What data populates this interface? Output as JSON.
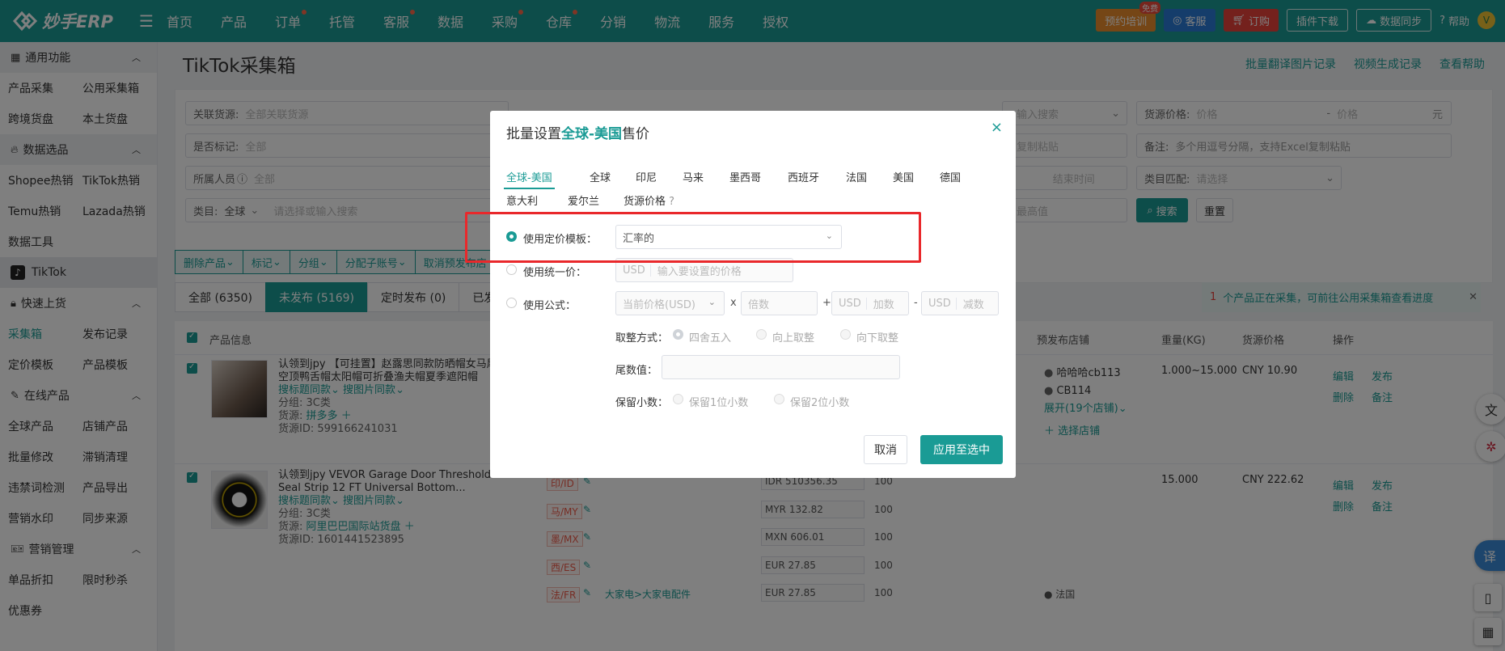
{
  "topbar": {
    "brand": "妙手ERP",
    "nav": [
      {
        "label": "首页",
        "dot": false
      },
      {
        "label": "产品",
        "dot": false
      },
      {
        "label": "订单",
        "dot": true
      },
      {
        "label": "托管",
        "dot": false
      },
      {
        "label": "客服",
        "dot": true
      },
      {
        "label": "数据",
        "dot": false
      },
      {
        "label": "采购",
        "dot": true
      },
      {
        "label": "仓库",
        "dot": true
      },
      {
        "label": "分销",
        "dot": false
      },
      {
        "label": "物流",
        "dot": false
      },
      {
        "label": "服务",
        "dot": false
      },
      {
        "label": "授权",
        "dot": false
      }
    ],
    "training": "预约培训",
    "training_badge": "免费",
    "service": "客服",
    "subscribe": "订购",
    "plugin": "插件下载",
    "sync": "数据同步",
    "help": "帮助",
    "avatar": "V"
  },
  "sidebar": {
    "common": "通用功能",
    "r1": [
      "产品采集",
      "公用采集箱"
    ],
    "r2": [
      "跨境货盘",
      "本土货盘"
    ],
    "data_select": "数据选品",
    "r3": [
      "Shopee热销",
      "TikTok热销"
    ],
    "r4": [
      "Temu热销",
      "Lazada热销"
    ],
    "r5": [
      "数据工具"
    ],
    "tiktok": "TikTok",
    "quick": "快速上货",
    "r6": [
      "采集箱",
      "发布记录"
    ],
    "r7": [
      "定价模板",
      "产品模板"
    ],
    "online": "在线产品",
    "r8": [
      "全球产品",
      "店铺产品"
    ],
    "r9": [
      "批量修改",
      "滞销清理"
    ],
    "r10": [
      "违禁词检测",
      "产品导出"
    ],
    "r11": [
      "营销水印",
      "同步来源"
    ],
    "marketing": "营销管理",
    "r12": [
      "单品折扣",
      "限时秒杀"
    ],
    "r13": [
      "优惠券"
    ]
  },
  "page": {
    "title": "TikTok采集箱",
    "links": [
      "批量翻译图片记录",
      "视频生成记录",
      "查看帮助"
    ]
  },
  "filters": {
    "source_label": "关联货源:",
    "source_ph": "全部关联货源",
    "mark_label": "是否标记:",
    "mark_val": "全部",
    "member_label": "所属人员",
    "member_val": "全部",
    "cat_label": "类目:",
    "cat_val": "全球",
    "cat_ph": "请选择或输入搜索",
    "search_ph": "输入搜索",
    "copy_ph": "复制粘贴",
    "end_time": "结束时间",
    "max_ph": "最高值",
    "price_label": "货源价格:",
    "price_ph": "价格",
    "dash": "-",
    "price_ph2": "价格",
    "yuan": "元",
    "note_label": "备注:",
    "note_ph": "多个用逗号分隔，支持Excel复制粘贴",
    "match_label": "类目匹配:",
    "match_ph": "请选择",
    "search_btn": "搜索",
    "reset_btn": "重置"
  },
  "actions": [
    "删除产品",
    "标记",
    "分组",
    "分配子账号",
    "取消预发布店"
  ],
  "tabs": [
    "全部 (6350)",
    "未发布 (5169)",
    "定时发布 (0)",
    "已发布"
  ],
  "notice": {
    "count": "1",
    "text": "个产品正在采集，可前往公用采集箱查看进度",
    "close": "✕"
  },
  "table": {
    "headers": {
      "info": "产品信息",
      "prestore": "预发布店铺",
      "weight": "重量(KG)",
      "price": "货源价格",
      "op": "操作"
    },
    "rows": [
      {
        "title1": "认领到jpy 【可挂置】赵露思同款防晒帽女马尾",
        "title2": "空顶鸭舌帽太阳帽可折叠渔夫帽夏季遮阳帽",
        "search1": "搜标题同款",
        "search2": "搜图片同款",
        "group": "分组: 3C类",
        "source_label": "货源:",
        "source": "拼多多",
        "sid": "货源ID: 599166241031",
        "stores": [
          "哈哈哈cb113",
          "CB114"
        ],
        "expand": "展开(19个店铺)",
        "choose": "选择店铺",
        "weight": "1.000~15.000",
        "price": "CNY 10.90",
        "ops": [
          "编辑",
          "发布",
          "删除",
          "备注"
        ]
      },
      {
        "title1": "认领到jpy VEVOR Garage Door Threshold",
        "title2": "Seal Strip 12 FT Universal Bottom...",
        "search1": "搜标题同款",
        "search2": "搜图片同款",
        "group": "分组: 3C类",
        "source_label": "货源:",
        "source": "阿里巴巴国际站货盘",
        "sid": "货源ID: 1601441523895",
        "weight": "15.000",
        "price": "CNY 222.62",
        "ops": [
          "编辑",
          "发布",
          "删除",
          "备注"
        ]
      }
    ],
    "subrows": [
      {
        "site": "印/ID",
        "cur": "IDR",
        "price": "510356.35",
        "stock": "100"
      },
      {
        "site": "马/MY",
        "cur": "MYR",
        "price": "132.82",
        "stock": "100"
      },
      {
        "site": "墨/MX",
        "cur": "MXN",
        "price": "606.01",
        "stock": "100"
      },
      {
        "site": "西/ES",
        "cur": "EUR",
        "price": "27.85",
        "stock": "100"
      },
      {
        "site": "法/FR",
        "cat": "大家电>大家电配件",
        "cur": "EUR",
        "price": "27.85",
        "stock": "100",
        "store": "法国"
      }
    ]
  },
  "modal": {
    "title_pre": "批量设置",
    "title_hl": "全球-美国",
    "title_post": "售价",
    "close": "×",
    "tabs": [
      "全球-美国",
      "全球",
      "印尼",
      "马来",
      "墨西哥",
      "西班牙",
      "法国",
      "美国",
      "德国",
      "意大利",
      "爱尔兰",
      "货源价格"
    ],
    "opt_template": "使用定价模板：",
    "template_val": "汇率的",
    "opt_unified": "使用统一价：",
    "usd": "USD",
    "unified_ph": "输入要设置的价格",
    "opt_formula": "使用公式：",
    "formula_base": "当前价格(USD)",
    "x": "x",
    "multiple_ph": "倍数",
    "plus": "+",
    "add_ph": "加数",
    "minus": "-",
    "sub_ph": "减数",
    "round_label": "取整方式：",
    "round_opts": [
      "四舍五入",
      "向上取整",
      "向下取整"
    ],
    "tail_label": "尾数值：",
    "decimal_label": "保留小数：",
    "decimal_opts": [
      "保留1位小数",
      "保留2位小数"
    ],
    "cancel": "取消",
    "apply": "应用至选中"
  },
  "floats": {
    "translate": "译"
  }
}
